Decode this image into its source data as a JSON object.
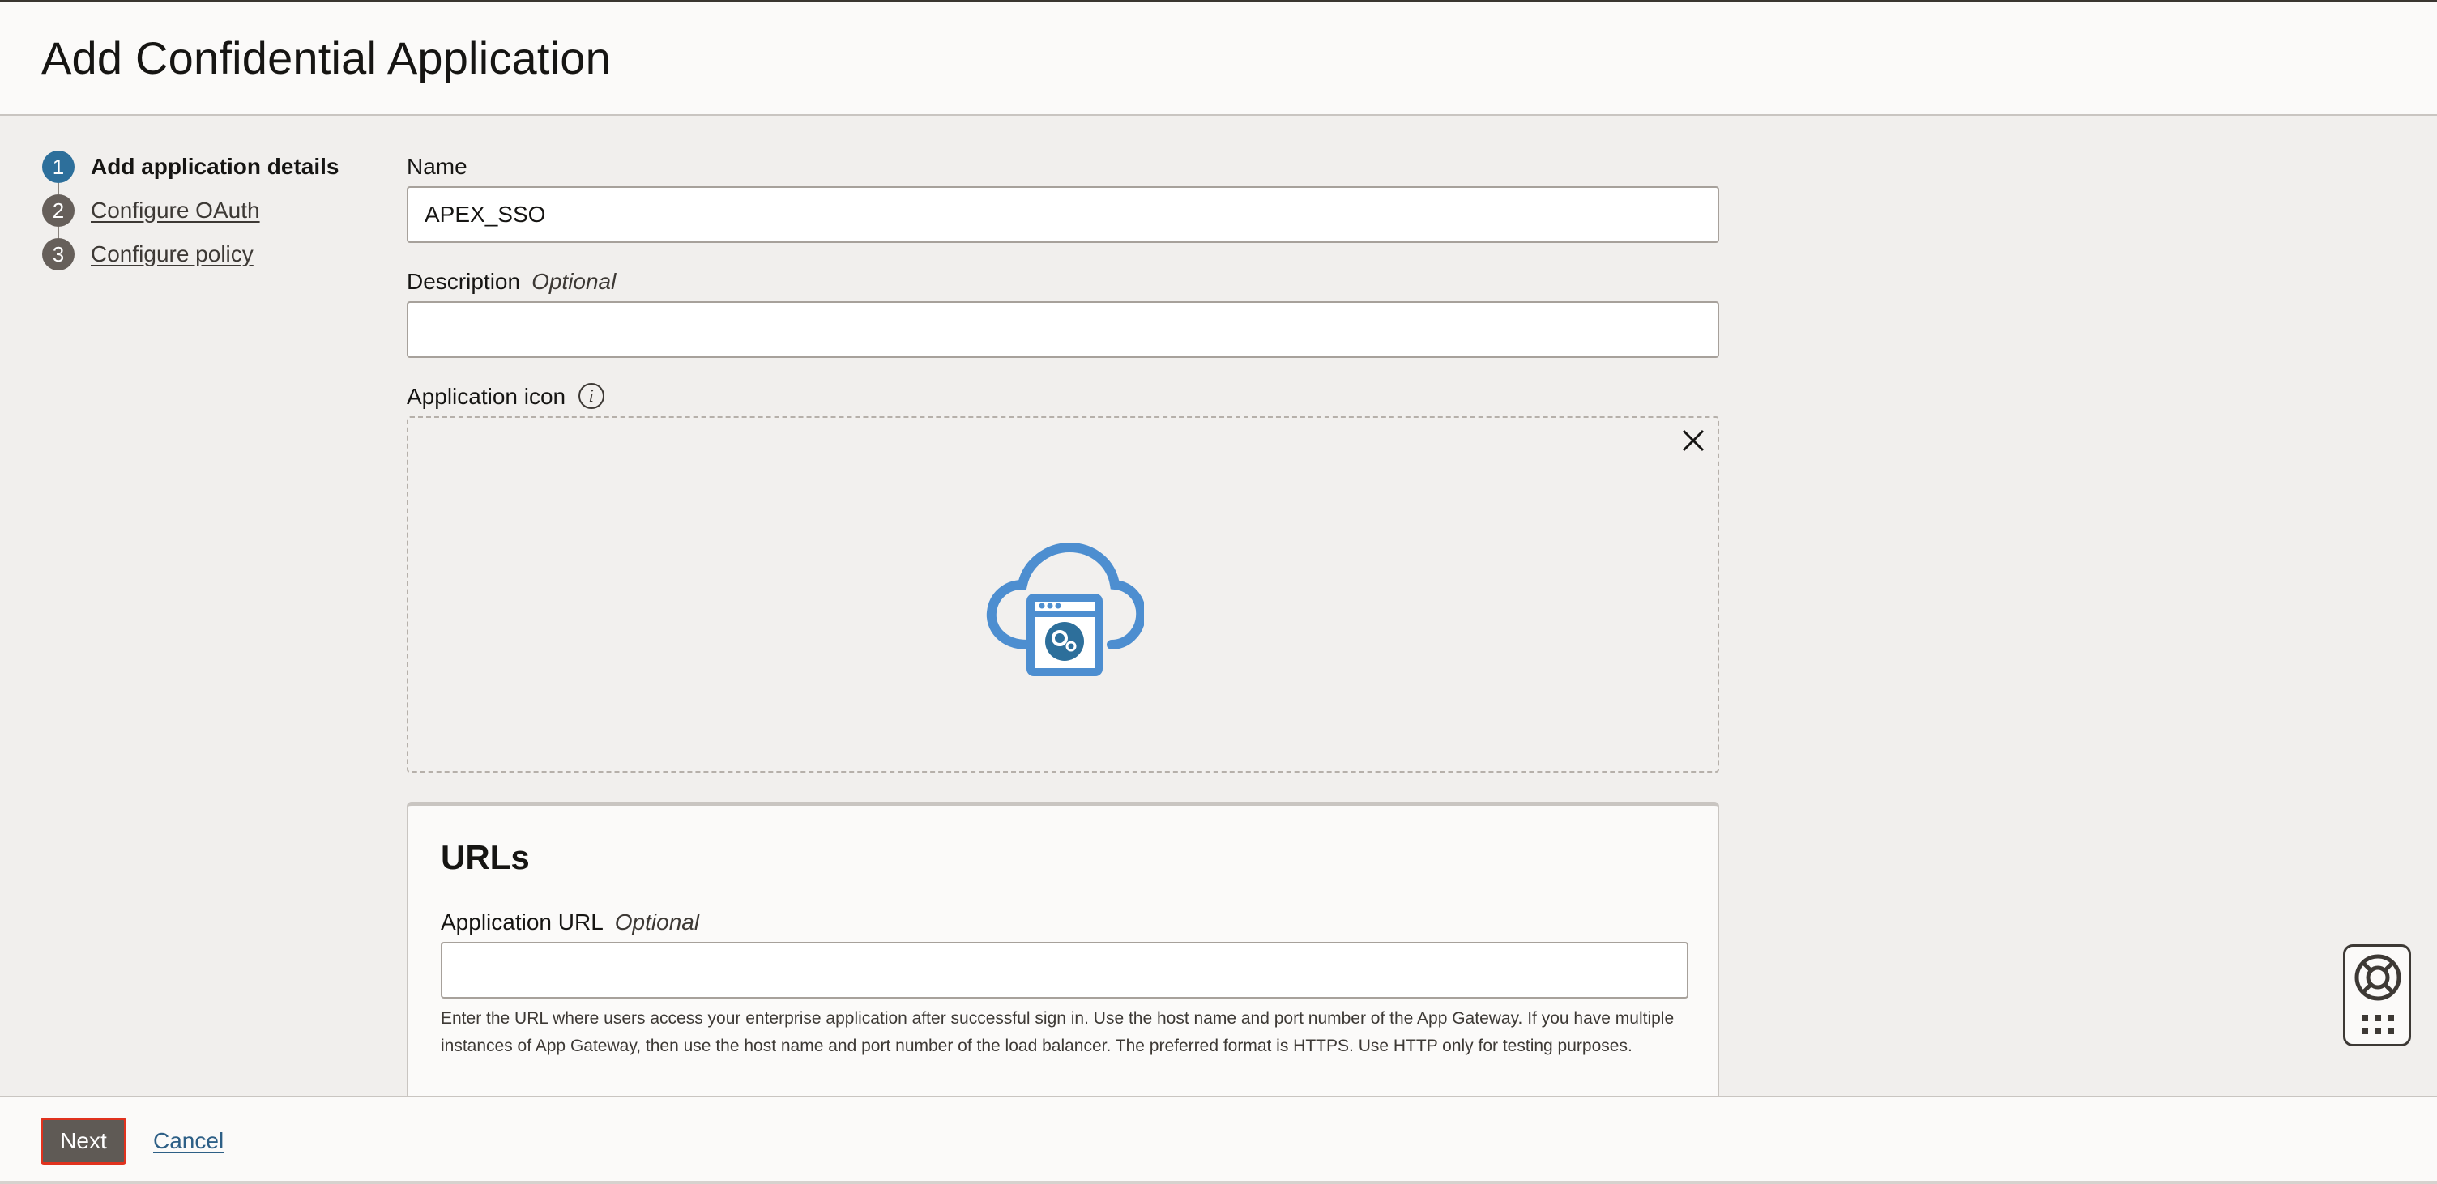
{
  "page": {
    "title": "Add Confidential Application"
  },
  "stepper": {
    "steps": [
      {
        "number": "1",
        "label": "Add application details",
        "active": true
      },
      {
        "number": "2",
        "label": "Configure OAuth",
        "active": false
      },
      {
        "number": "3",
        "label": "Configure policy",
        "active": false
      }
    ]
  },
  "form": {
    "name": {
      "label": "Name",
      "value": "APEX_SSO"
    },
    "description": {
      "label": "Description",
      "optional": "Optional",
      "value": ""
    },
    "application_icon": {
      "label": "Application icon",
      "info_icon": "info-icon",
      "remove_icon": "close-icon",
      "preview_icon": "cloud-app-icon"
    }
  },
  "urls": {
    "title": "URLs",
    "application_url": {
      "label": "Application URL",
      "optional": "Optional",
      "value": "",
      "help": "Enter the URL where users access your enterprise application after successful sign in. Use the host name and port number of the App Gateway. If you have multiple instances of App Gateway, then use the host name and port number of the load balancer. The preferred format is HTTPS. Use HTTP only for testing purposes."
    }
  },
  "footer": {
    "next_label": "Next",
    "cancel_label": "Cancel"
  },
  "help_widget": {
    "icon": "lifebuoy-icon",
    "menu_icon": "grid-menu-icon"
  },
  "colors": {
    "accent": "#2d6f9b",
    "step_inactive": "#665f5a",
    "next_button": "#5f5a55",
    "focus_border": "#e0321e",
    "link": "#2d5f86",
    "icon_blue": "#4d8ed0"
  }
}
